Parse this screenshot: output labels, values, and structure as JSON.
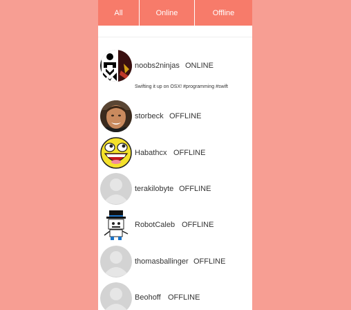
{
  "tabs": [
    {
      "label": "All"
    },
    {
      "label": "Online"
    },
    {
      "label": "Offline"
    }
  ],
  "users": [
    {
      "name": "noobs2ninjas",
      "status": "ONLINE",
      "bio": "Swifting it up on OSX! #programming #swift",
      "avatar": "ninja-avatar-icon"
    },
    {
      "name": "storbeck",
      "status": "OFFLINE",
      "avatar": "photo-avatar"
    },
    {
      "name": "Habathcx",
      "status": "OFFLINE",
      "avatar": "smiley-avatar-icon"
    },
    {
      "name": "terakilobyte",
      "status": "OFFLINE",
      "avatar": "default-user-icon"
    },
    {
      "name": "RobotCaleb",
      "status": "OFFLINE",
      "avatar": "robot-avatar-icon"
    },
    {
      "name": "thomasballinger",
      "status": "OFFLINE",
      "avatar": "default-user-icon"
    },
    {
      "name": "Beohoff",
      "status": "OFFLINE",
      "avatar": "default-user-icon"
    }
  ],
  "colors": {
    "background": "#F79E93",
    "tab_bar": "#F77B6A",
    "panel": "#FFFFFF"
  }
}
